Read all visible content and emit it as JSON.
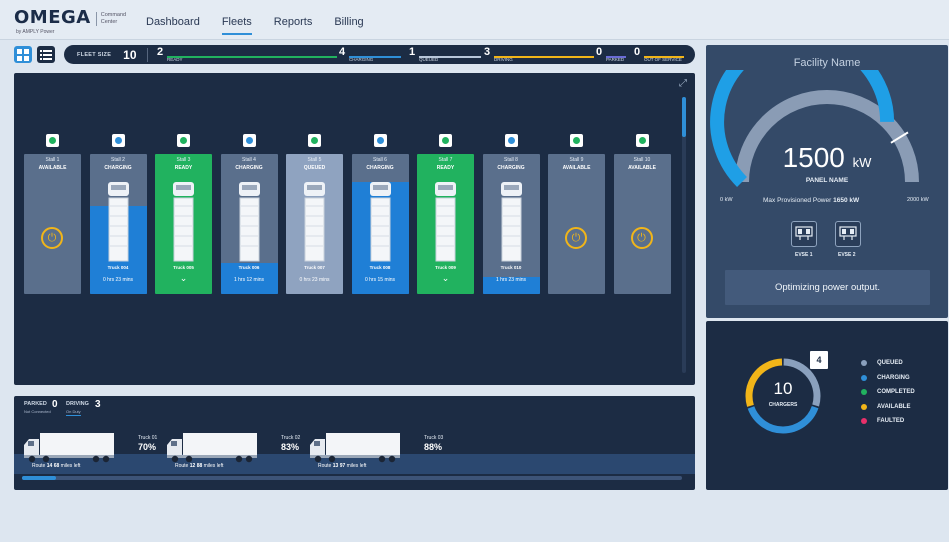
{
  "brand": {
    "name": "OMEGA",
    "sub": "Command Center",
    "tag": "by AMPLY Power"
  },
  "nav": {
    "items": [
      "Dashboard",
      "Fleets",
      "Reports",
      "Billing"
    ],
    "active": "Fleets"
  },
  "fleet": {
    "size_label": "FLEET SIZE",
    "size": "10",
    "segments": [
      {
        "count": "2",
        "label": "READY",
        "color": "#21b25f"
      },
      {
        "count": "4",
        "label": "CHARGING",
        "color": "#2f8fd8"
      },
      {
        "count": "1",
        "label": "QUEUED",
        "color": "#b8c7da"
      },
      {
        "count": "3",
        "label": "DRIVING",
        "color": "#f1b519"
      },
      {
        "count": "0",
        "label": "PARKED",
        "color": "#6a6cd6"
      },
      {
        "count": "0",
        "label": "OUT OF SERVICE",
        "color": "#f1b519"
      }
    ]
  },
  "stalls": [
    {
      "name": "Stall 1",
      "status": "AVAILABLE",
      "dot": "#21b25f",
      "kind": "available"
    },
    {
      "name": "Stall 2",
      "status": "CHARGING",
      "dot": "#2f8fd8",
      "kind": "charging",
      "fill": 0.63,
      "truck": "Truck 004",
      "time": "0 hrs 23 mins"
    },
    {
      "name": "Stall 3",
      "status": "READY",
      "dot": "#21b25f",
      "kind": "ready",
      "truck": "Truck 005"
    },
    {
      "name": "Stall 4",
      "status": "CHARGING",
      "dot": "#2f8fd8",
      "kind": "charging",
      "fill": 0.22,
      "truck": "Truck 006",
      "time": "1 hrs 12 mins"
    },
    {
      "name": "Stall 5",
      "status": "QUEUED",
      "dot": "#21b25f",
      "kind": "queued",
      "truck": "Truck 007",
      "time": "0 hrs 23 mins"
    },
    {
      "name": "Stall 6",
      "status": "CHARGING",
      "dot": "#2f8fd8",
      "kind": "charging",
      "fill": 0.8,
      "truck": "Truck 008",
      "time": "0 hrs 15 mins"
    },
    {
      "name": "Stall 7",
      "status": "READY",
      "dot": "#21b25f",
      "kind": "ready",
      "truck": "Truck 009"
    },
    {
      "name": "Stall 8",
      "status": "CHARGING",
      "dot": "#2f8fd8",
      "kind": "charging",
      "fill": 0.12,
      "truck": "Truck 010",
      "time": "1 hrs 23 mins"
    },
    {
      "name": "Stall 9",
      "status": "AVAILABLE",
      "dot": "#21b25f",
      "kind": "available"
    },
    {
      "name": "Stall 10",
      "status": "AVAILABLE",
      "dot": "#21b25f",
      "kind": "available"
    }
  ],
  "road": {
    "parked_label": "PARKED",
    "parked": "0",
    "parked_sub": "Not Connected",
    "driving_label": "DRIVING",
    "driving": "3",
    "driving_sub": "On Duty",
    "progress": 0.05,
    "trucks": [
      {
        "name": "Truck 01",
        "pct": "70%",
        "route_label": "Route",
        "route": "14",
        "miles": "68",
        "miles_suffix": "miles left"
      },
      {
        "name": "Truck 02",
        "pct": "83%",
        "route_label": "Route",
        "route": "12",
        "miles": "88",
        "miles_suffix": "miles left"
      },
      {
        "name": "Truck 03",
        "pct": "88%",
        "route_label": "Route",
        "route": "13",
        "miles": "97",
        "miles_suffix": "miles left"
      }
    ]
  },
  "facility": {
    "name": "Facility Name",
    "power_value": "1500",
    "power_unit": "kW",
    "panel_name": "PANEL NAME",
    "min": "0 kW",
    "max": "2000 kW",
    "max_prov_label": "Max Provisioned Power",
    "max_prov_value": "1650 kW",
    "gauge_level": 0.75,
    "gauge_marker": 0.825,
    "evse": [
      "EVSE 1",
      "EVSE 2"
    ],
    "status_message": "Optimizing power output."
  },
  "chargers": {
    "count": "10",
    "label": "CHARGERS",
    "badge": "4",
    "segments": [
      {
        "name": "QUEUED",
        "color": "#8aa0bd",
        "value": 3
      },
      {
        "name": "CHARGING",
        "color": "#2f8fd8",
        "value": 4
      },
      {
        "name": "COMPLETED",
        "color": "#21b25f",
        "value": 0
      },
      {
        "name": "AVAILABLE",
        "color": "#f1b519",
        "value": 3
      },
      {
        "name": "FAULTED",
        "color": "#e8306a",
        "value": 0
      }
    ]
  }
}
